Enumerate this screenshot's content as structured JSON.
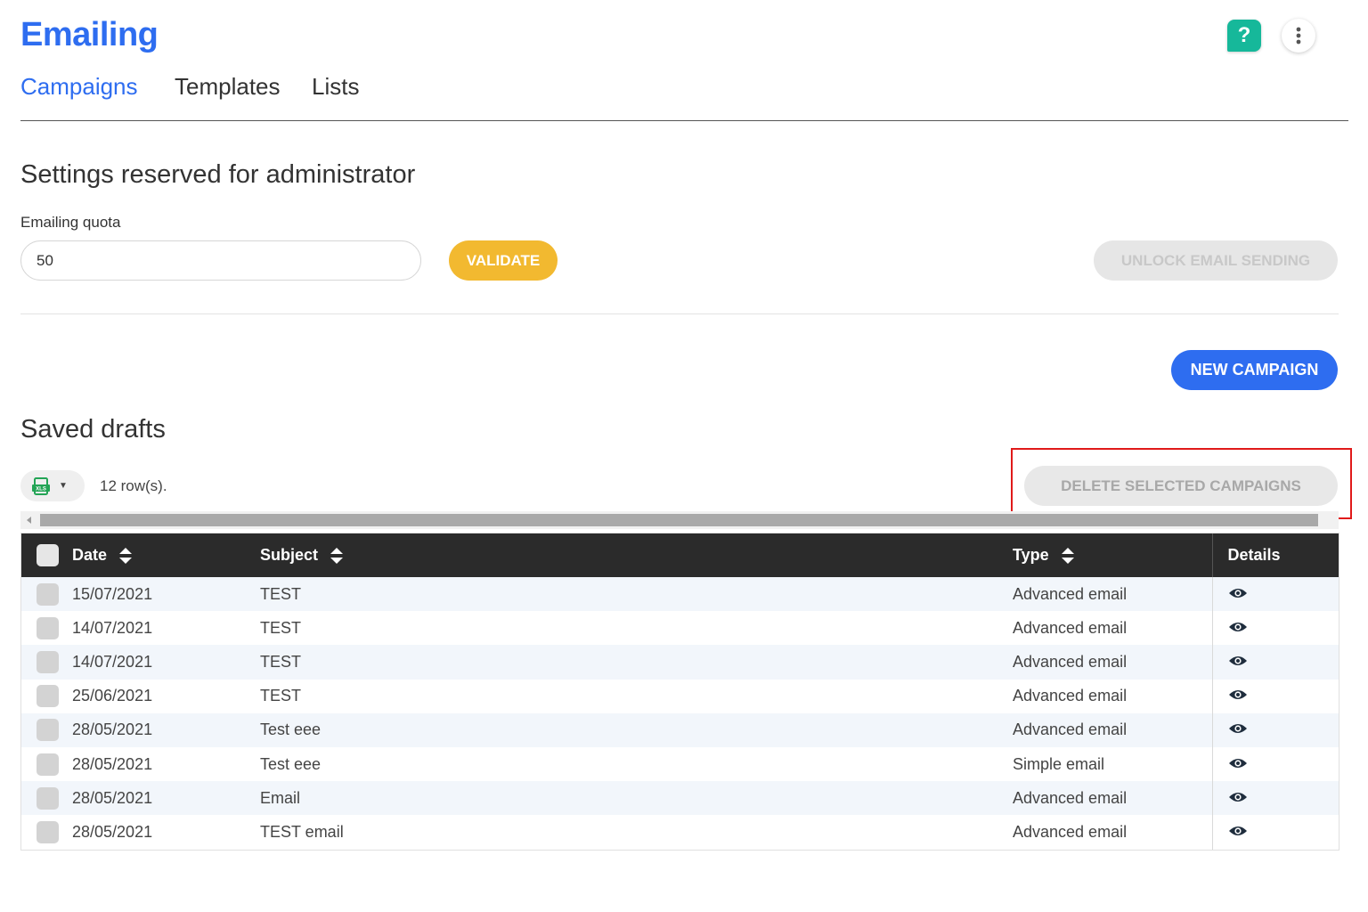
{
  "app": {
    "title": "Emailing"
  },
  "header": {
    "help_label": "?"
  },
  "tabs": [
    {
      "label": "Campaigns",
      "active": true
    },
    {
      "label": "Templates",
      "active": false
    },
    {
      "label": "Lists",
      "active": false
    }
  ],
  "admin": {
    "section_title": "Settings reserved for administrator",
    "quota_label": "Emailing quota",
    "quota_value": "50",
    "validate_label": "VALIDATE",
    "unlock_label": "UNLOCK EMAIL SENDING"
  },
  "actions": {
    "new_campaign_label": "NEW CAMPAIGN"
  },
  "drafts": {
    "title": "Saved drafts",
    "row_count": "12 row(s).",
    "delete_label": "DELETE SELECTED CAMPAIGNS",
    "export_icon": "spreadsheet-export-icon",
    "columns": {
      "date": "Date",
      "subject": "Subject",
      "type": "Type",
      "details": "Details"
    },
    "rows": [
      {
        "date": "15/07/2021",
        "subject": "TEST",
        "type": "Advanced email"
      },
      {
        "date": "14/07/2021",
        "subject": "TEST",
        "type": "Advanced email"
      },
      {
        "date": "14/07/2021",
        "subject": "TEST",
        "type": "Advanced email"
      },
      {
        "date": "25/06/2021",
        "subject": "TEST",
        "type": "Advanced email"
      },
      {
        "date": "28/05/2021",
        "subject": "Test eee",
        "type": "Advanced email"
      },
      {
        "date": "28/05/2021",
        "subject": "Test eee",
        "type": "Simple email"
      },
      {
        "date": "28/05/2021",
        "subject": "Email",
        "type": "Advanced email"
      },
      {
        "date": "28/05/2021",
        "subject": "TEST email",
        "type": "Advanced email"
      }
    ]
  },
  "colors": {
    "brand_blue": "#2e6df0",
    "validate_yellow": "#f2b930",
    "help_green": "#16b89a",
    "highlight_red": "#e01a1a",
    "table_header": "#2b2b2b"
  }
}
